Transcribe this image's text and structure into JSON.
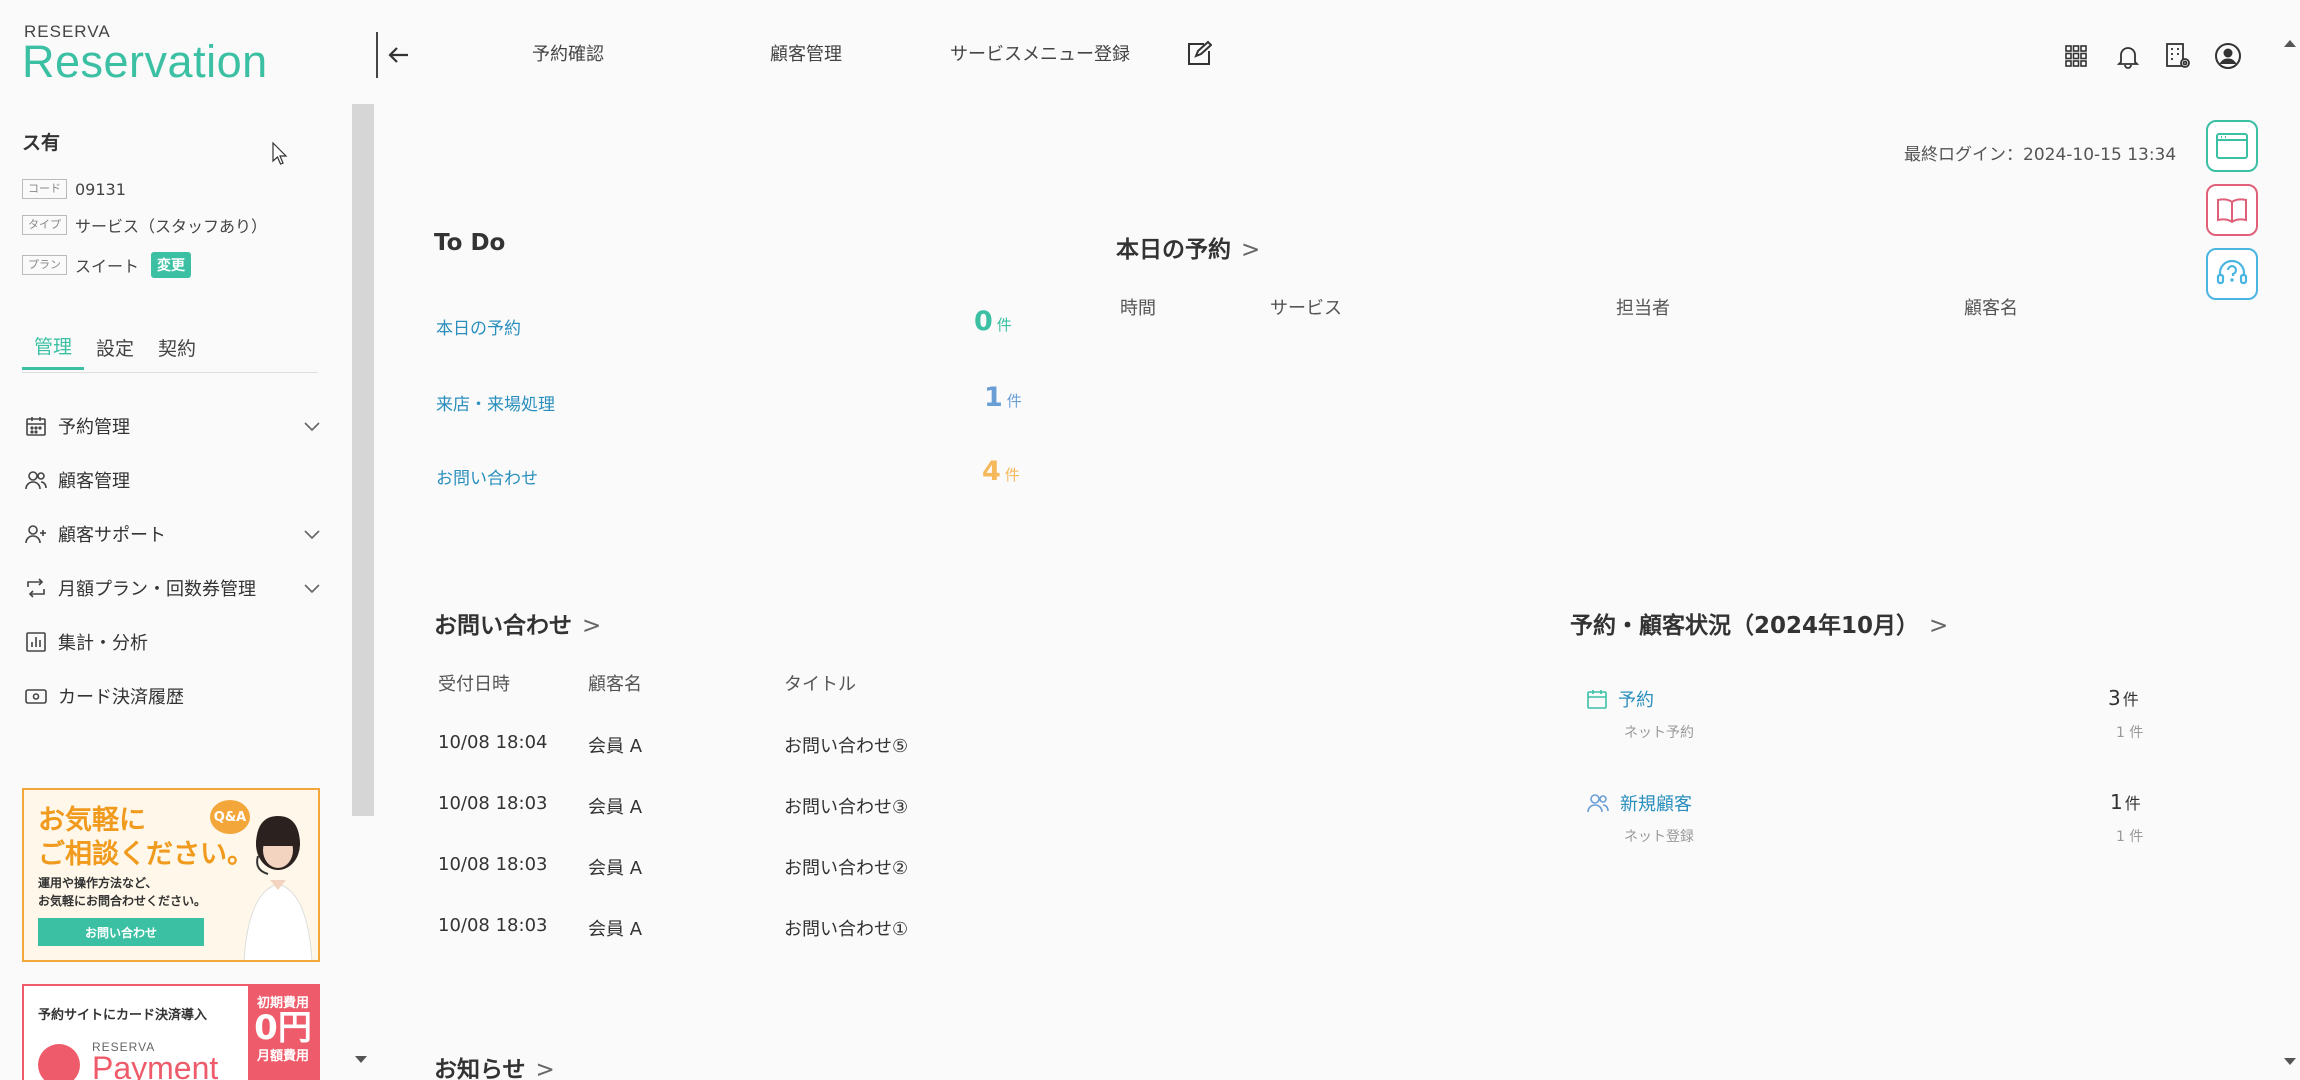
{
  "app": {
    "logo_small": "RESERVA",
    "logo_big": "Reservation"
  },
  "colors": {
    "accent": "#3cc0a4",
    "link": "#2a8fbd",
    "todo_zero": "#3cc0a4",
    "todo_one": "#6a9fd6",
    "todo_four": "#f5b85a",
    "support_icon": "#e0607a"
  },
  "store": {
    "name": "ス有",
    "code_tag": "コード",
    "code": "09131",
    "type_tag": "タイプ",
    "type": "サービス（スタッフあり）",
    "plan_tag": "プラン",
    "plan": "スイート",
    "change_label": "変更"
  },
  "sidebar": {
    "tabs": [
      {
        "label": "管理",
        "active": true
      },
      {
        "label": "設定",
        "active": false
      },
      {
        "label": "契約",
        "active": false
      }
    ],
    "menu": [
      {
        "label": "予約管理",
        "icon": "calendar-icon",
        "expandable": true
      },
      {
        "label": "顧客管理",
        "icon": "users-icon",
        "expandable": false
      },
      {
        "label": "顧客サポート",
        "icon": "user-plus-icon",
        "expandable": true
      },
      {
        "label": "月額プラン・回数券管理",
        "icon": "repeat-icon",
        "expandable": true
      },
      {
        "label": "集計・分析",
        "icon": "chart-icon",
        "expandable": false
      },
      {
        "label": "カード決済履歴",
        "icon": "card-icon",
        "expandable": false
      }
    ],
    "banner_contact": {
      "title_line1": "お気軽に",
      "title_line2": "ご相談ください。",
      "badge": "Q&A",
      "sub_line1": "運用や操作方法など、",
      "sub_line2": "お気軽にお問合わせください。",
      "button": "お問い合わせ"
    },
    "banner_payment": {
      "text": "予約サイトにカード決済導入",
      "fee_label1": "初期費用",
      "fee_value": "0円",
      "fee_label2": "月額費用",
      "logo_small": "RESERVA",
      "logo_big": "Payment"
    }
  },
  "topnav": {
    "items": [
      "予約確認",
      "顧客管理",
      "サービスメニュー登録"
    ]
  },
  "last_login": "最終ログイン：2024-10-15 13:34",
  "todo": {
    "title": "To Do",
    "items": [
      {
        "label": "本日の予約",
        "count": "0",
        "unit": "件"
      },
      {
        "label": "来店・来場処理",
        "count": "1",
        "unit": "件"
      },
      {
        "label": "お問い合わせ",
        "count": "4",
        "unit": "件"
      }
    ]
  },
  "today": {
    "title": "本日の予約",
    "arrow": ">",
    "headers": [
      "時間",
      "サービス",
      "担当者",
      "顧客名"
    ]
  },
  "inquiries": {
    "title": "お問い合わせ",
    "arrow": ">",
    "headers": [
      "受付日時",
      "顧客名",
      "タイトル"
    ],
    "rows": [
      {
        "date": "10/08 18:04",
        "customer": "会員 A",
        "title": "お問い合わせ⑤"
      },
      {
        "date": "10/08 18:03",
        "customer": "会員 A",
        "title": "お問い合わせ③"
      },
      {
        "date": "10/08 18:03",
        "customer": "会員 A",
        "title": "お問い合わせ②"
      },
      {
        "date": "10/08 18:03",
        "customer": "会員 A",
        "title": "お問い合わせ①"
      }
    ]
  },
  "status": {
    "title": "予約・顧客状況（2024年10月）",
    "arrow": ">",
    "items": [
      {
        "label": "予約",
        "sub": "ネット予約",
        "value": "3",
        "unit": "件",
        "sub_value": "1 件",
        "icon": "calendar-icon"
      },
      {
        "label": "新規顧客",
        "sub": "ネット登録",
        "value": "1",
        "unit": "件",
        "sub_value": "1 件",
        "icon": "users-icon"
      }
    ]
  },
  "news": {
    "title": "お知らせ",
    "arrow": ">"
  }
}
